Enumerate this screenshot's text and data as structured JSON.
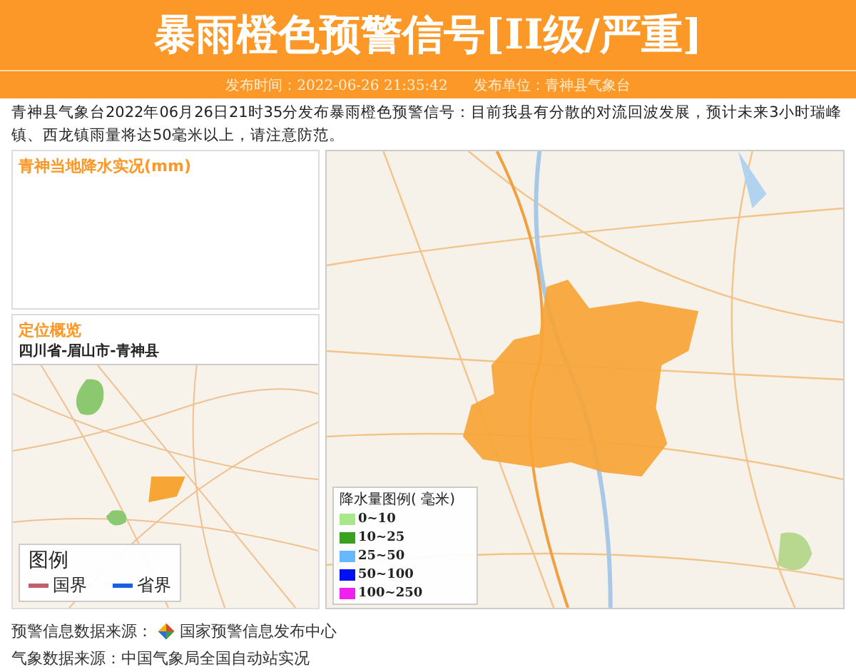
{
  "header": {
    "title": "暴雨橙色预警信号[II级/严重]",
    "publish_time": "发布时间：2022-06-26 21:35:42",
    "publisher": "发布单位：青神县气象台"
  },
  "description": "青神县气象台2022年06月26日21时35分发布暴雨橙色预警信号：目前我县有分散的对流回波发展，预计未来3小时瑞峰镇、西龙镇雨量将达50毫米以上，请注意防范。",
  "rain_panel": {
    "title": "青神当地降水实况(mm)"
  },
  "location_panel": {
    "title": "定位概览",
    "path": "四川省-眉山市-青神县",
    "legend": {
      "title": "图例",
      "items": [
        {
          "label": "国界",
          "color": "#c0606a"
        },
        {
          "label": "省界",
          "color": "#1a5fe0"
        }
      ]
    }
  },
  "map_legend": {
    "title": "降水量图例( 毫米)",
    "items": [
      {
        "label": "0~10",
        "color": "#a8e88a"
      },
      {
        "label": "10~25",
        "color": "#3aa020"
      },
      {
        "label": "25~50",
        "color": "#66b8ff"
      },
      {
        "label": "50~100",
        "color": "#0010f0"
      },
      {
        "label": "100~250",
        "color": "#f020f0"
      }
    ]
  },
  "footer": {
    "warning_source_label": "预警信息数据来源：",
    "warning_source": "国家预警信息发布中心",
    "weather_source": "气象数据来源：中国气象局全国自动站实况"
  }
}
